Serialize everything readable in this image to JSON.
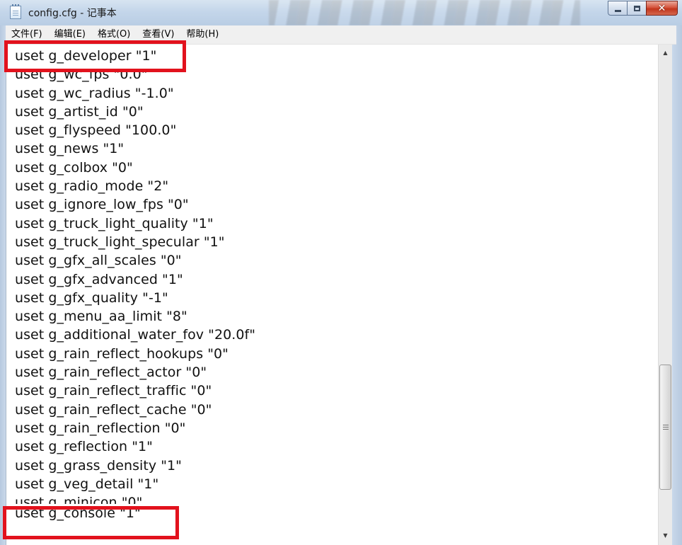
{
  "window": {
    "title": "config.cfg - 记事本"
  },
  "caption": {
    "minimize_icon": "minimize-icon",
    "maximize_icon": "maximize-icon",
    "close_glyph": "✕"
  },
  "menu": {
    "items": [
      {
        "label": "文件(F)"
      },
      {
        "label": "编辑(E)"
      },
      {
        "label": "格式(O)"
      },
      {
        "label": "查看(V)"
      },
      {
        "label": "帮助(H)"
      }
    ]
  },
  "editor": {
    "lines": [
      "uset g_developer \"1\"",
      "uset g_wc_fps \"0.0\"",
      "uset g_wc_radius \"-1.0\"",
      "uset g_artist_id \"0\"",
      "uset g_flyspeed \"100.0\"",
      "uset g_news \"1\"",
      "uset g_colbox \"0\"",
      "uset g_radio_mode \"2\"",
      "uset g_ignore_low_fps \"0\"",
      "uset g_truck_light_quality \"1\"",
      "uset g_truck_light_specular \"1\"",
      "uset g_gfx_all_scales \"0\"",
      "uset g_gfx_advanced \"1\"",
      "uset g_gfx_quality \"-1\"",
      "uset g_menu_aa_limit \"8\"",
      "uset g_additional_water_fov \"20.0f\"",
      "uset g_rain_reflect_hookups \"0\"",
      "uset g_rain_reflect_actor \"0\"",
      "uset g_rain_reflect_traffic \"0\"",
      "uset g_rain_reflect_cache \"0\"",
      "uset g_rain_reflection \"0\"",
      "uset g_reflection \"1\"",
      "uset g_grass_density \"1\"",
      "uset g_veg_detail \"1\"",
      "uset g_minicon \"0\"",
      "uset g_console \"1\""
    ]
  },
  "highlight": {
    "color": "#e2121d"
  },
  "scrollbar": {
    "up_glyph": "▲",
    "down_glyph": "▼"
  }
}
